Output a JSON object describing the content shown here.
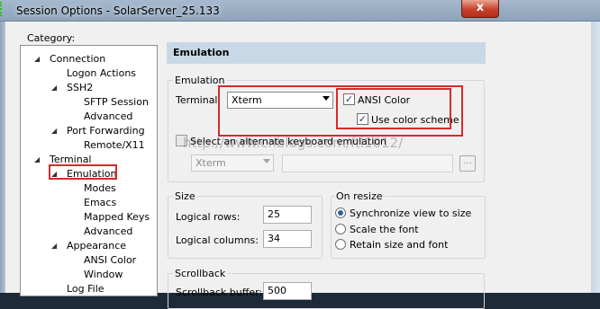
{
  "window": {
    "title": "Session Options - SolarServer_25.133",
    "close_glyph": "x"
  },
  "category": {
    "label": "Category:",
    "items": [
      "Connection",
      "Logon Actions",
      "SSH2",
      "SFTP Session",
      "Advanced",
      "Port Forwarding",
      "Remote/X11",
      "Terminal",
      "Emulation",
      "Modes",
      "Emacs",
      "Mapped Keys",
      "Advanced",
      "Appearance",
      "ANSI Color",
      "Window",
      "Log File"
    ],
    "selected": "Emulation"
  },
  "emulation": {
    "header": "Emulation",
    "group_label": "Emulation",
    "terminal_label": "Terminal:",
    "terminal_value": "Xterm",
    "ansi_color_label": "ANSI Color",
    "ansi_color_checked": true,
    "use_color_scheme_label": "Use color scheme",
    "use_color_scheme_checked": true,
    "alt_keyboard_label": "Select an alternate keyboard emulation",
    "alt_keyboard_checked": false,
    "alt_keyboard_value": "Xterm",
    "browse_glyph": "..."
  },
  "size": {
    "group_label": "Size",
    "logical_rows_label": "Logical rows:",
    "logical_rows_value": "25",
    "logical_columns_label": "Logical columns:",
    "logical_columns_value": "34"
  },
  "on_resize": {
    "group_label": "On resize",
    "options": [
      "Synchronize view to size",
      "Scale the font",
      "Retain size and font"
    ],
    "selected": "Synchronize view to size"
  },
  "scrollback": {
    "group_label": "Scrollback",
    "buffer_label": "Scrollback buffer:",
    "buffer_value": "500"
  },
  "watermark": "http://www.cnblogs.com/ftl1012/",
  "colors": {
    "highlight": "#d62a2a",
    "header_bg": "#c9d8e6",
    "titlebar": "#a6b9cd"
  }
}
